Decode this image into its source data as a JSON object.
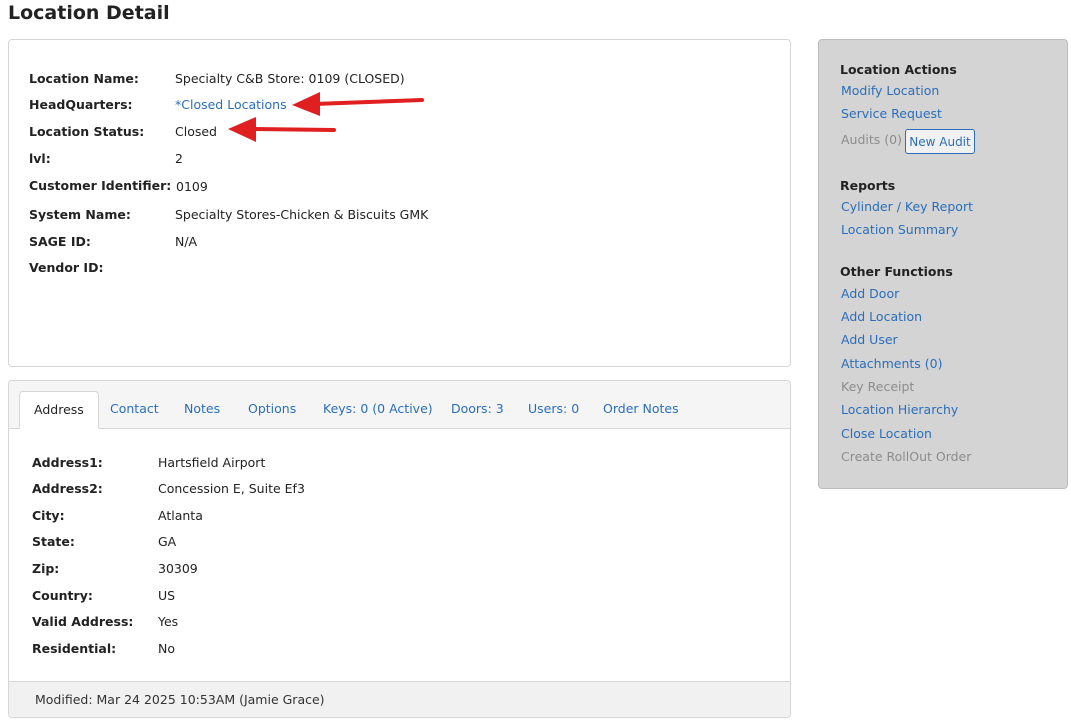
{
  "page": {
    "title": "Location Detail"
  },
  "location": {
    "fields": [
      {
        "label": "Location Name:",
        "value": "Specialty C&B Store: 0109 (CLOSED)"
      },
      {
        "label": "HeadQuarters:",
        "value": "*Closed Locations"
      },
      {
        "label": "Location Status:",
        "value": "Closed"
      },
      {
        "label": "lvl:",
        "value": "2"
      },
      {
        "label": "Customer Identifier:",
        "value": "0109"
      },
      {
        "label": "System Name:",
        "value": "Specialty Stores-Chicken & Biscuits GMK"
      },
      {
        "label": "SAGE ID:",
        "value": "N/A"
      },
      {
        "label": "Vendor ID:",
        "value": ""
      }
    ]
  },
  "tabs": [
    {
      "label": "Address"
    },
    {
      "label": "Contact"
    },
    {
      "label": "Notes"
    },
    {
      "label": "Options"
    },
    {
      "label": "Keys: 0 (0 Active)"
    },
    {
      "label": "Doors: 3"
    },
    {
      "label": "Users: 0"
    },
    {
      "label": "Order Notes"
    }
  ],
  "address": {
    "fields": [
      {
        "label": "Address1:",
        "value": "Hartsfield Airport"
      },
      {
        "label": "Address2:",
        "value": "Concession E, Suite Ef3"
      },
      {
        "label": "City:",
        "value": "Atlanta"
      },
      {
        "label": "State:",
        "value": "GA"
      },
      {
        "label": "Zip:",
        "value": "30309"
      },
      {
        "label": "Country:",
        "value": "US"
      },
      {
        "label": "Valid Address:",
        "value": "Yes"
      },
      {
        "label": "Residential:",
        "value": "No"
      }
    ]
  },
  "footer": {
    "modified": "Modified: Mar 24 2025 10:53AM (Jamie Grace)"
  },
  "sidebar": {
    "location_actions": {
      "heading": "Location Actions",
      "modify": "Modify Location",
      "service_request": "Service Request",
      "audits": "Audits (0)",
      "new_audit": "New Audit"
    },
    "reports": {
      "heading": "Reports",
      "cylinder_key": "Cylinder / Key Report",
      "location_summary": "Location Summary"
    },
    "other_functions": {
      "heading": "Other Functions",
      "add_door": "Add Door",
      "add_location": "Add Location",
      "add_user": "Add User",
      "attachments": "Attachments (0)",
      "key_receipt": "Key Receipt",
      "location_hierarchy": "Location Hierarchy",
      "close_location": "Close Location",
      "create_rollout": "Create RollOut Order"
    }
  },
  "colors": {
    "link": "#2a6ebb",
    "annotation_arrow": "#e02020",
    "sidebar_bg": "#d4d4d4"
  }
}
